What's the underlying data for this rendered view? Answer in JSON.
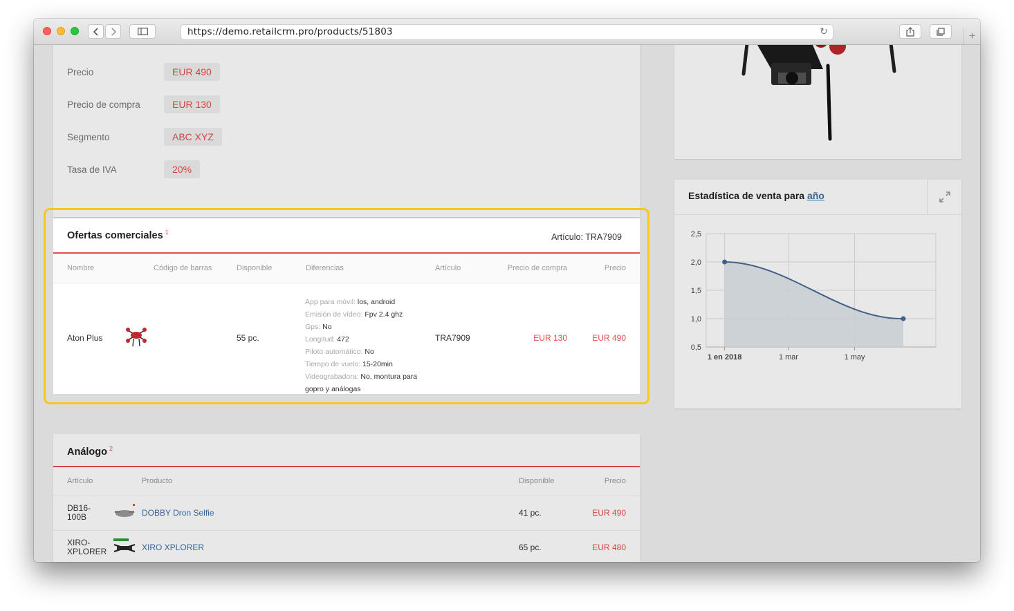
{
  "browser": {
    "url": "https://demo.retailcrm.pro/products/51803",
    "new_tab": "+"
  },
  "product_fields": [
    {
      "label": "Precio",
      "value": "EUR 490"
    },
    {
      "label": "Precio de compra",
      "value": "EUR 130"
    },
    {
      "label": "Segmento",
      "value": "ABC XYZ"
    },
    {
      "label": "Tasa de IVA",
      "value": "20%"
    }
  ],
  "offers": {
    "title": "Ofertas comerciales",
    "count": "1",
    "article_label": "Artículo: TRA7909",
    "columns": [
      "Nombre",
      "Código de barras",
      "Disponible",
      "Diferencias",
      "Artículo",
      "Precio de compra",
      "Precio"
    ],
    "row": {
      "name": "Aton Plus",
      "available": "55 pc.",
      "article": "TRA7909",
      "purchase_price": "EUR 130",
      "price": "EUR 490",
      "differences": [
        {
          "key": "App para móvil:",
          "value": "los, android"
        },
        {
          "key": "Emisión de vídeo:",
          "value": "Fpv 2.4 ghz"
        },
        {
          "key": "Gps:",
          "value": "No"
        },
        {
          "key": "Longitud:",
          "value": "472"
        },
        {
          "key": "Piloto automático:",
          "value": "No"
        },
        {
          "key": "Tiempo de vuelo:",
          "value": "15-20min"
        },
        {
          "key": "Videograbadora:",
          "value": "No, montura para gopro y análogas"
        }
      ]
    }
  },
  "analogs": {
    "title": "Análogo",
    "count": "2",
    "columns": [
      "Artículo",
      "Producto",
      "Disponible",
      "Precio"
    ],
    "rows": [
      {
        "article_1": "DB16-",
        "article_2": "100B",
        "product": "DOBBY Dron Selfie",
        "available": "41 pc.",
        "price": "EUR 490"
      },
      {
        "article_1": "XIRO-",
        "article_2": "XPLORER",
        "product": "XIRO XPLORER",
        "available": "65 pc.",
        "price": "EUR 480"
      }
    ]
  },
  "stats": {
    "title": "Estadística de venta para",
    "period_link": "año"
  },
  "chart_data": {
    "type": "area",
    "title": "Estadística de venta para año",
    "y_ticks": [
      "2,5",
      "2,0",
      "1,5",
      "1,0",
      "0,5"
    ],
    "x_ticks": [
      "1 en 2018",
      "1 mar",
      "1 may"
    ],
    "ylim": [
      0.5,
      2.5
    ],
    "series": [
      {
        "points": [
          {
            "x": "2018-01-01",
            "y": 2.0
          },
          {
            "x": "2018-06-15",
            "y": 1.0
          }
        ]
      }
    ],
    "grid": true,
    "colors": {
      "line": "#4a6a94",
      "fill": "#dde3ea"
    }
  },
  "colors": {
    "accent_red": "#e84b4b",
    "link_blue": "#3d6fa8",
    "highlight": "#f7c71c"
  }
}
